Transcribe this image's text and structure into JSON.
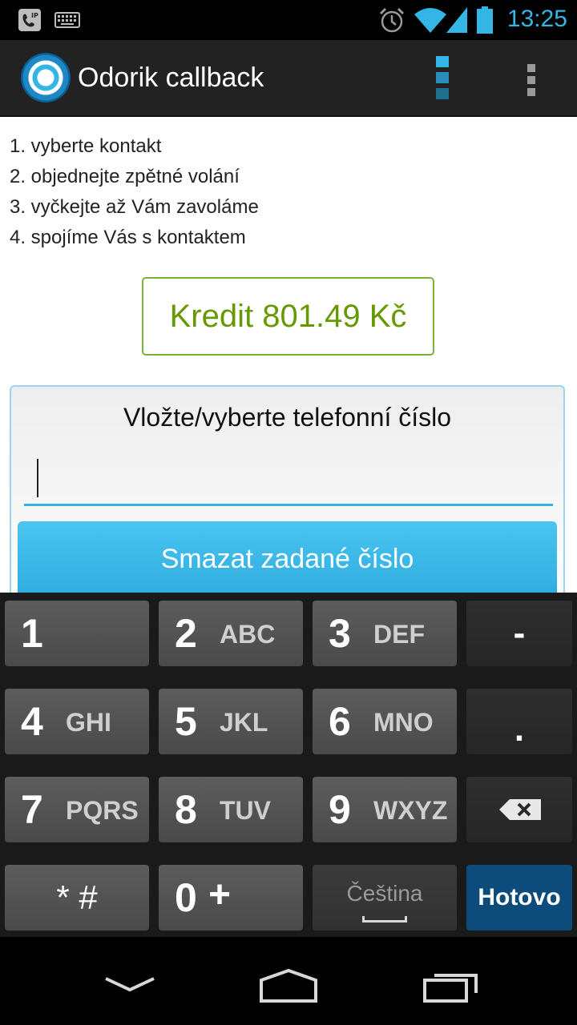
{
  "status_bar": {
    "time": "13:25",
    "icons": [
      "sip-phone-icon",
      "keyboard-icon",
      "alarm-icon",
      "wifi-icon",
      "signal-icon",
      "battery-icon"
    ]
  },
  "action_bar": {
    "title": "Odorik callback",
    "icons": [
      "app-logo-icon",
      "contacts-icon",
      "overflow-menu-icon"
    ]
  },
  "steps": [
    "1. vyberte kontakt",
    "2. objednejte zpětné volání",
    "3. vyčkejte až Vám zavoláme",
    "4. spojíme Vás s kontaktem"
  ],
  "credit": "Kredit 801.49 Kč",
  "phone_panel": {
    "label": "Vložte/vyberte telefonní číslo",
    "value": "",
    "clear_label": "Smazat zadané číslo"
  },
  "keyboard": {
    "keys": [
      {
        "num": "1",
        "letters": ""
      },
      {
        "num": "2",
        "letters": "ABC"
      },
      {
        "num": "3",
        "letters": "DEF"
      },
      {
        "num": "4",
        "letters": "GHI"
      },
      {
        "num": "5",
        "letters": "JKL"
      },
      {
        "num": "6",
        "letters": "MNO"
      },
      {
        "num": "7",
        "letters": "PQRS"
      },
      {
        "num": "8",
        "letters": "TUV"
      },
      {
        "num": "9",
        "letters": "WXYZ"
      },
      {
        "num": "0",
        "letters": "+"
      }
    ],
    "dash": "-",
    "dot": ".",
    "star_hash": "* #",
    "language": "Čeština",
    "done": "Hotovo"
  },
  "nav_bar": {
    "icons": [
      "back-icon",
      "home-icon",
      "recent-apps-icon"
    ]
  },
  "colors": {
    "accent": "#33b5e5",
    "credit_green": "#669900",
    "done_key": "#0d4b7a"
  }
}
